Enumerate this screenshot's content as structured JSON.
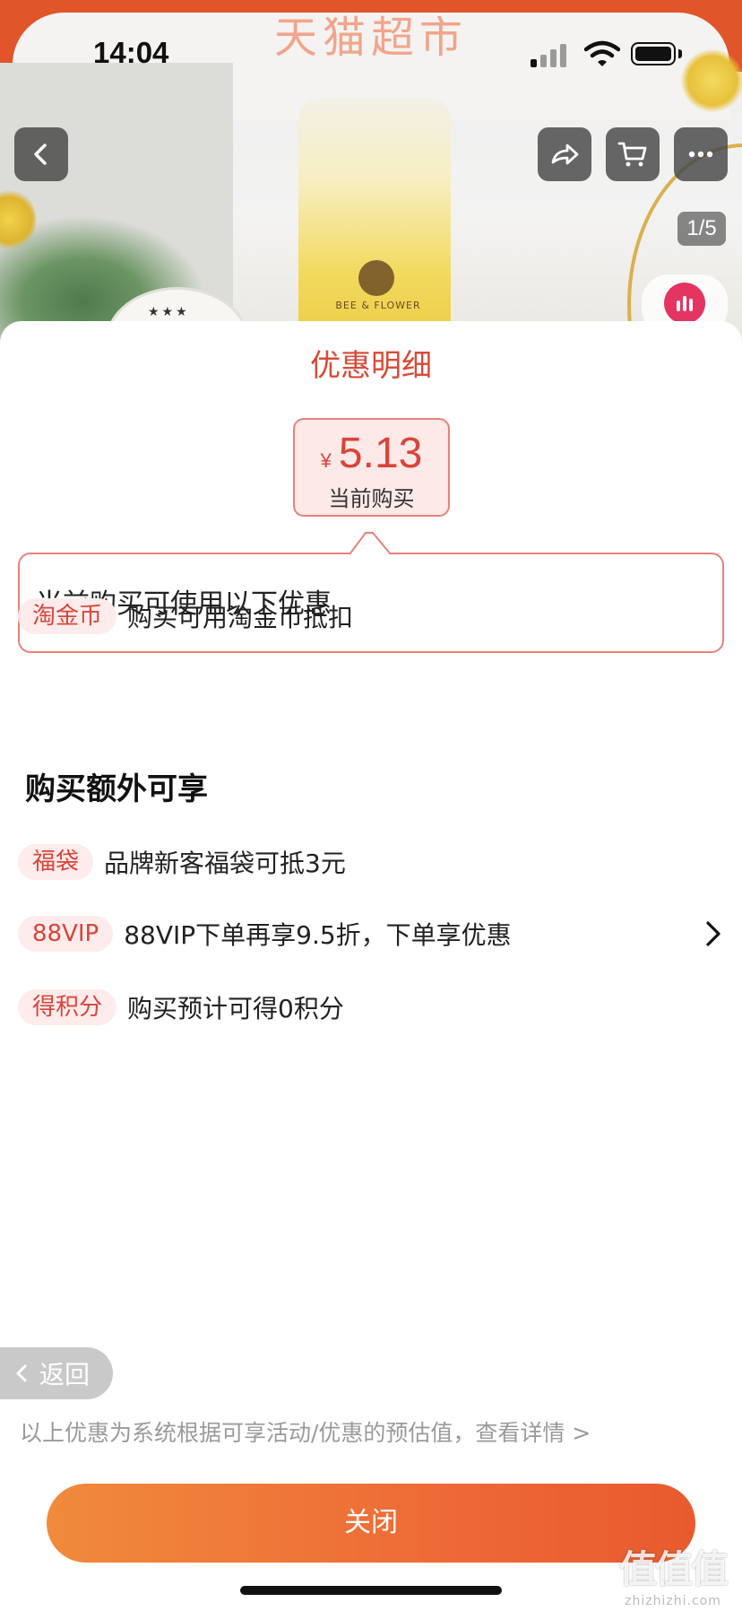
{
  "background": {
    "banner_title": "天猫超市",
    "product_brand": "BEE & FLOWER",
    "plate_stars": "★★★"
  },
  "status_bar": {
    "time": "14:04"
  },
  "top_nav": {
    "back_icon": "chevron-left-icon",
    "share_icon": "share-icon",
    "cart_icon": "cart-icon",
    "more_icon": "more-icon",
    "page_counter": "1/5"
  },
  "sheet": {
    "title": "优惠明细",
    "price": {
      "currency": "¥",
      "value": "5.13",
      "label": "当前购买"
    },
    "callout_text": "当前购买可使用以下优惠",
    "current_offers": [
      {
        "tag": "淘金币",
        "text": "购买可用淘金币抵扣"
      }
    ],
    "extra_heading": "购买额外可享",
    "extra_offers": [
      {
        "tag": "福袋",
        "text": "品牌新客福袋可抵3元",
        "has_chevron": false
      },
      {
        "tag": "88VIP",
        "text": "88VIP下单再享9.5折，下单享优惠",
        "has_chevron": true
      },
      {
        "tag": "得积分",
        "text": "购买预计可得0积分",
        "has_chevron": false
      }
    ],
    "back_label": "返回",
    "disclaimer": "以上优惠为系统根据可享活动/优惠的预估值，查看详情 >",
    "close_label": "关闭"
  },
  "watermark": {
    "main": "值值值",
    "sub": "zhizhizhi.com"
  },
  "colors": {
    "accent": "#d9443a",
    "tag_background": "#fdeceb",
    "close_gradient_start": "#f08a3c",
    "close_gradient_end": "#e85a2e"
  }
}
